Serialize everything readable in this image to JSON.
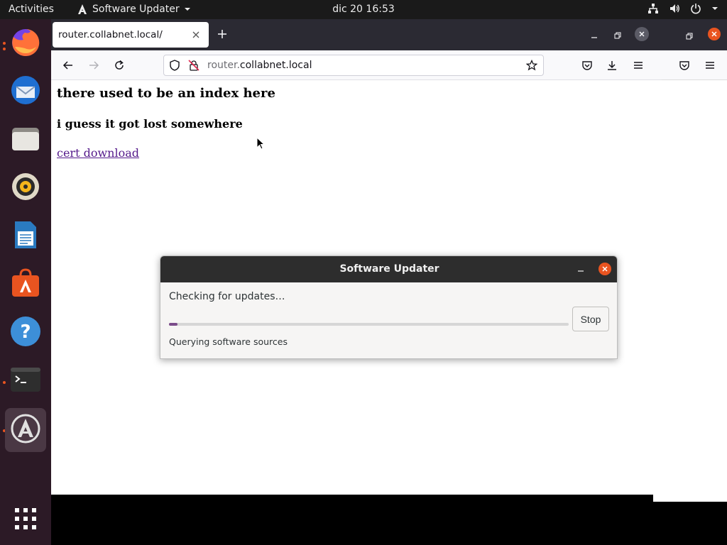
{
  "topbar": {
    "activities": "Activities",
    "app_name": "Software Updater",
    "clock": "dic 20  16:53",
    "tray_icons": [
      "network-icon",
      "volume-icon",
      "power-icon",
      "chevron-down-icon"
    ]
  },
  "dock": {
    "items": [
      {
        "name": "firefox",
        "running": true
      },
      {
        "name": "thunderbird",
        "running": false
      },
      {
        "name": "files",
        "running": false
      },
      {
        "name": "rhythmbox",
        "running": false
      },
      {
        "name": "libreoffice-writer",
        "running": false
      },
      {
        "name": "ubuntu-software",
        "running": false
      },
      {
        "name": "help",
        "running": false
      },
      {
        "name": "terminal",
        "running": true
      },
      {
        "name": "software-updater",
        "running": true
      }
    ],
    "show_apps": "show-applications-icon"
  },
  "browser": {
    "tab_title": "router.collabnet.local/",
    "url_dim": "router.",
    "url_main": "collabnet.local",
    "page": {
      "heading": "there used to be an index here",
      "subheading": "i guess it got lost somewhere",
      "link": "cert download"
    }
  },
  "dialog": {
    "title": "Software Updater",
    "status": "Checking for updates…",
    "stop_label": "Stop",
    "detail": "Querying software sources",
    "progress_fraction": 0.02
  },
  "colors": {
    "accent": "#e95420",
    "dock_bg": "#2c1a26",
    "progress": "#7b4c8a",
    "link_visited": "#551a8b"
  }
}
